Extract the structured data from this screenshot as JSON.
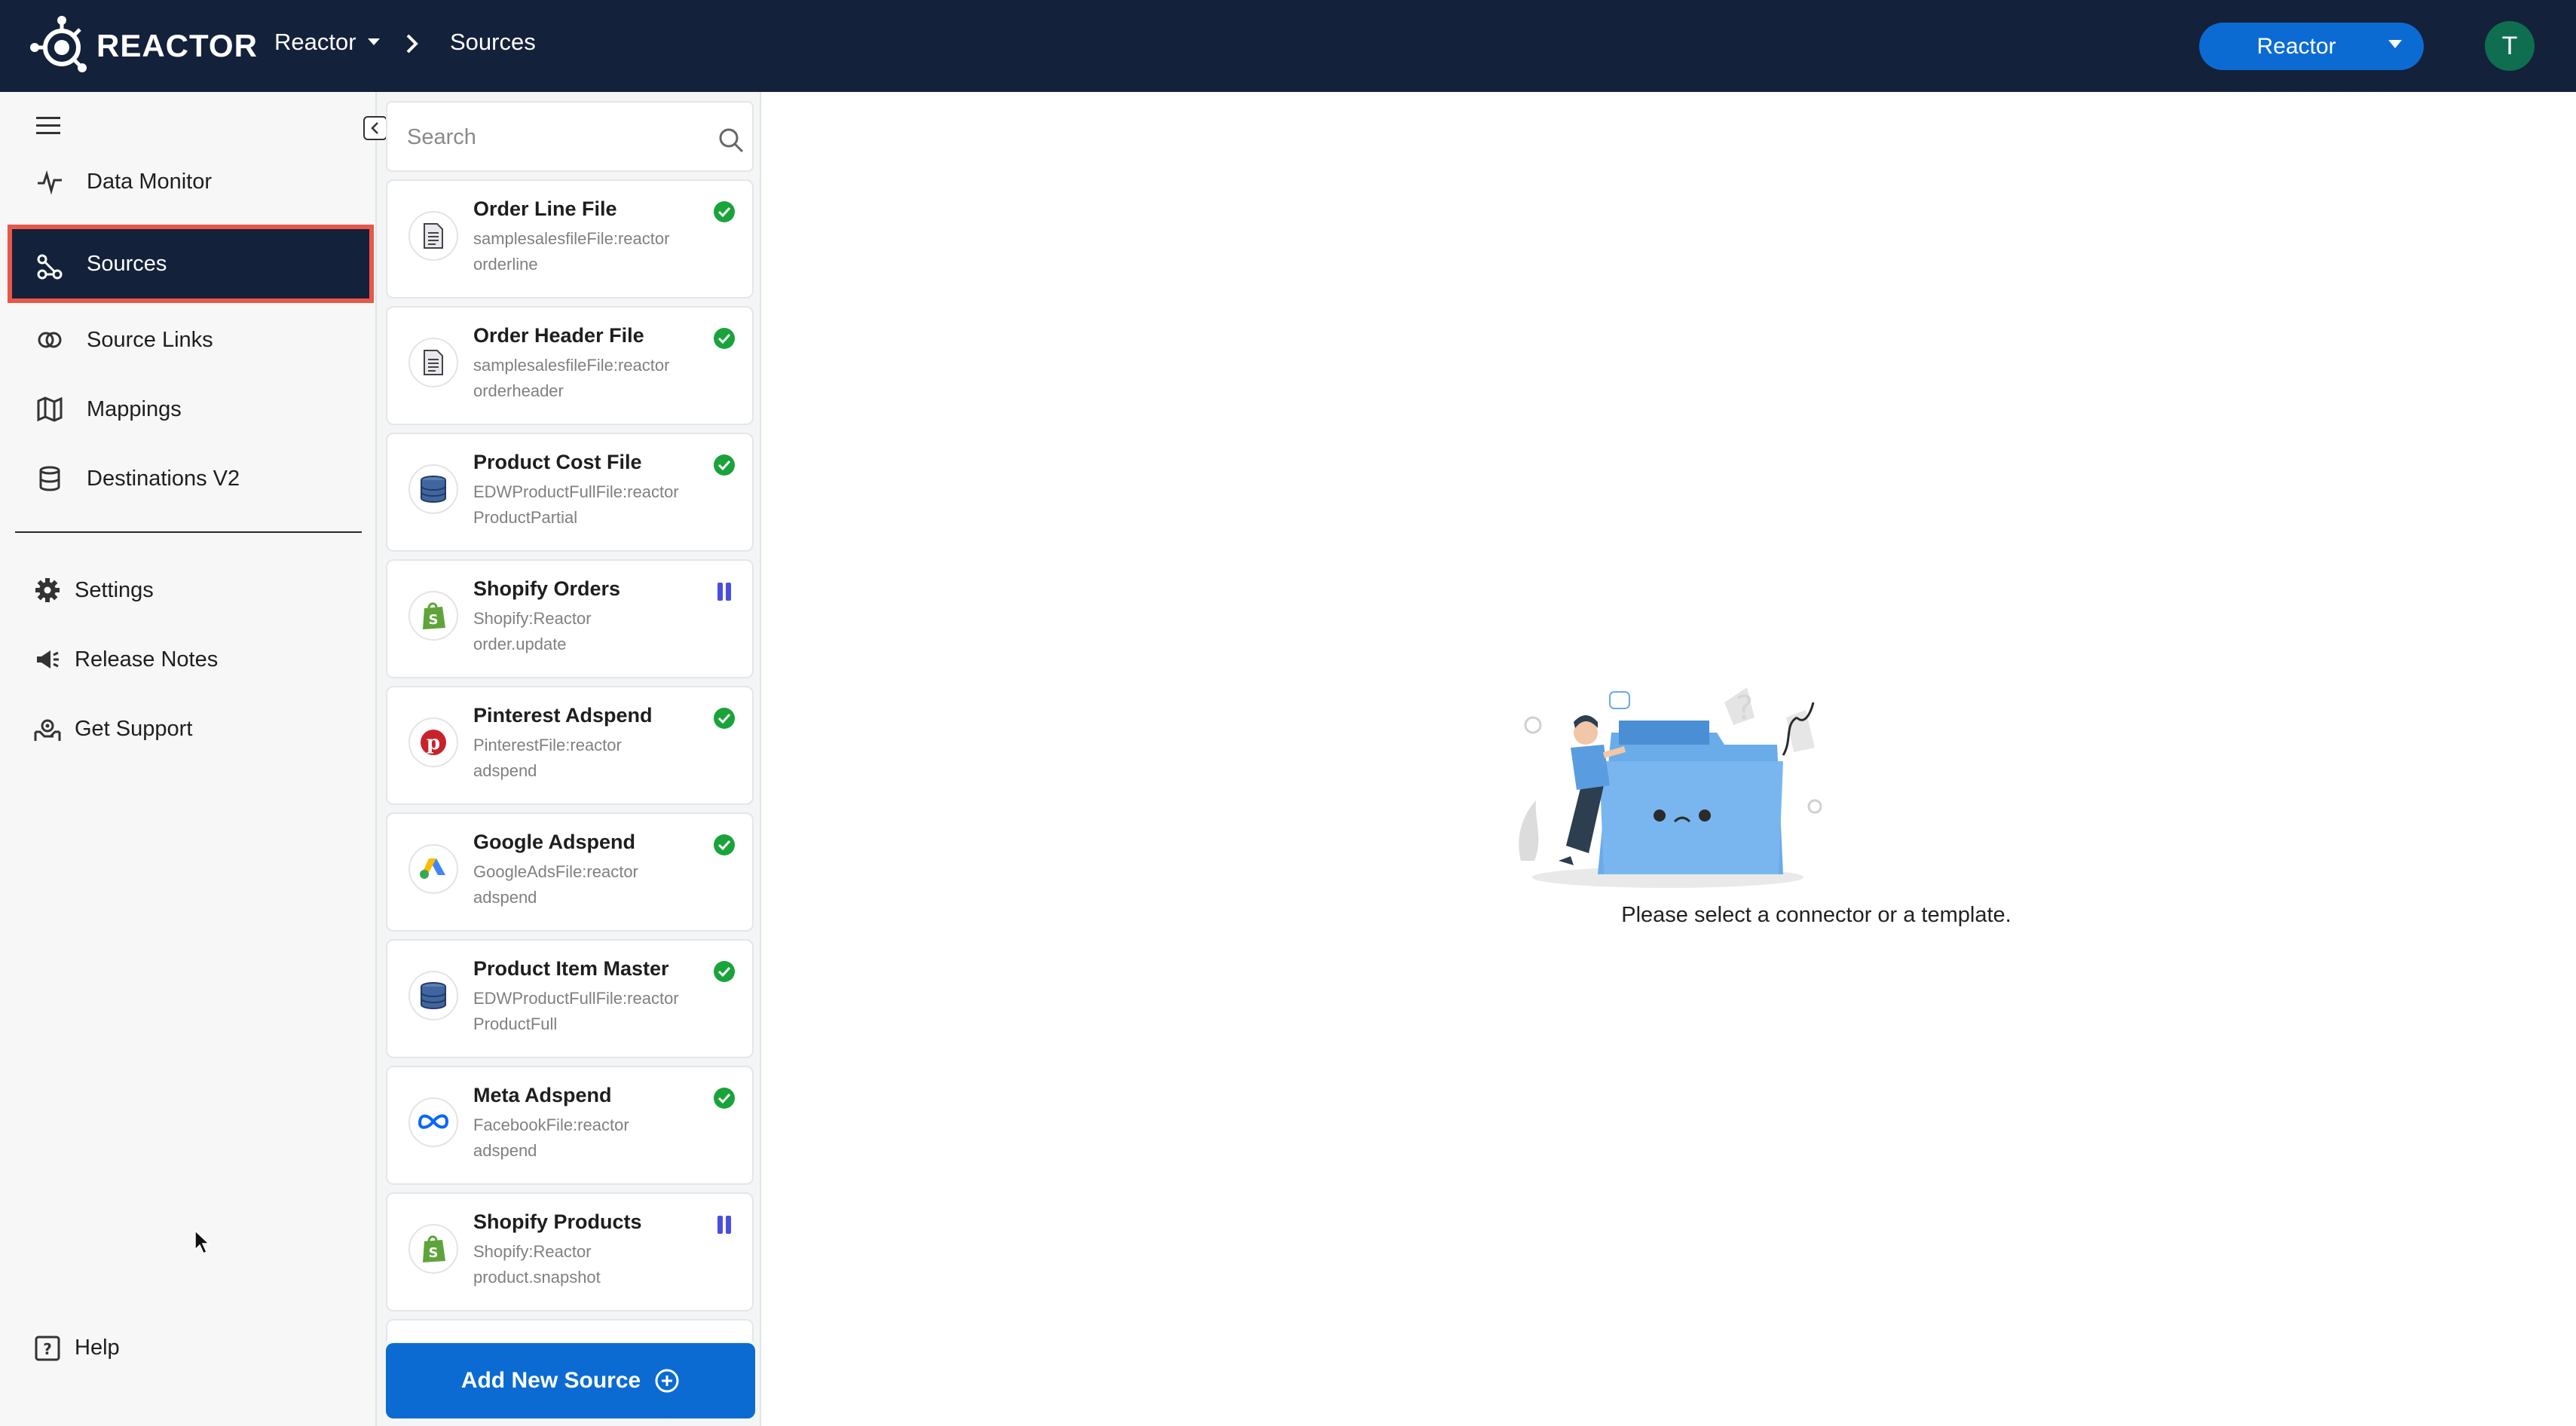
{
  "header": {
    "logo_text": "REACTOR",
    "breadcrumb_workspace": "Reactor",
    "breadcrumb_current": "Sources",
    "workspace_button": "Reactor",
    "avatar_initial": "T"
  },
  "sidebar": {
    "items": [
      {
        "label": "Data Monitor",
        "icon": "activity-icon"
      },
      {
        "label": "Sources",
        "icon": "sources-icon",
        "active": true
      },
      {
        "label": "Source Links",
        "icon": "link-icon"
      },
      {
        "label": "Mappings",
        "icon": "map-icon"
      },
      {
        "label": "Destinations V2",
        "icon": "database-icon"
      }
    ],
    "secondary": [
      {
        "label": "Settings",
        "icon": "gear-icon"
      },
      {
        "label": "Release Notes",
        "icon": "megaphone-icon"
      },
      {
        "label": "Get Support",
        "icon": "support-icon"
      }
    ],
    "help_label": "Help"
  },
  "sources_panel": {
    "search_placeholder": "Search",
    "items": [
      {
        "name": "Order Line File",
        "line1": "samplesalesfileFile:reactor",
        "line2": "orderline",
        "icon": "file-icon",
        "status": "active"
      },
      {
        "name": "Order Header File",
        "line1": "samplesalesfileFile:reactor",
        "line2": "orderheader",
        "icon": "file-icon",
        "status": "active"
      },
      {
        "name": "Product Cost File",
        "line1": "EDWProductFullFile:reactor",
        "line2": "ProductPartial",
        "icon": "database-icon",
        "status": "active"
      },
      {
        "name": "Shopify Orders",
        "line1": "Shopify:Reactor",
        "line2": "order.update",
        "icon": "shopify-icon",
        "status": "paused"
      },
      {
        "name": "Pinterest Adspend",
        "line1": "PinterestFile:reactor",
        "line2": "adspend",
        "icon": "pinterest-icon",
        "status": "active"
      },
      {
        "name": "Google Adspend",
        "line1": "GoogleAdsFile:reactor",
        "line2": "adspend",
        "icon": "google-ads-icon",
        "status": "active"
      },
      {
        "name": "Product Item Master",
        "line1": "EDWProductFullFile:reactor",
        "line2": "ProductFull",
        "icon": "database-icon",
        "status": "active"
      },
      {
        "name": "Meta Adspend",
        "line1": "FacebookFile:reactor",
        "line2": "adspend",
        "icon": "meta-icon",
        "status": "active"
      },
      {
        "name": "Shopify Products",
        "line1": "Shopify:Reactor",
        "line2": "product.snapshot",
        "icon": "shopify-icon",
        "status": "paused"
      }
    ],
    "add_button": "Add New Source"
  },
  "main": {
    "empty_message": "Please select a connector or a template."
  },
  "colors": {
    "header_bg": "#14213a",
    "primary": "#0b6bd3",
    "active_outline": "#e8574a",
    "status_active": "#1aa33a",
    "status_paused": "#4a4ee0"
  }
}
